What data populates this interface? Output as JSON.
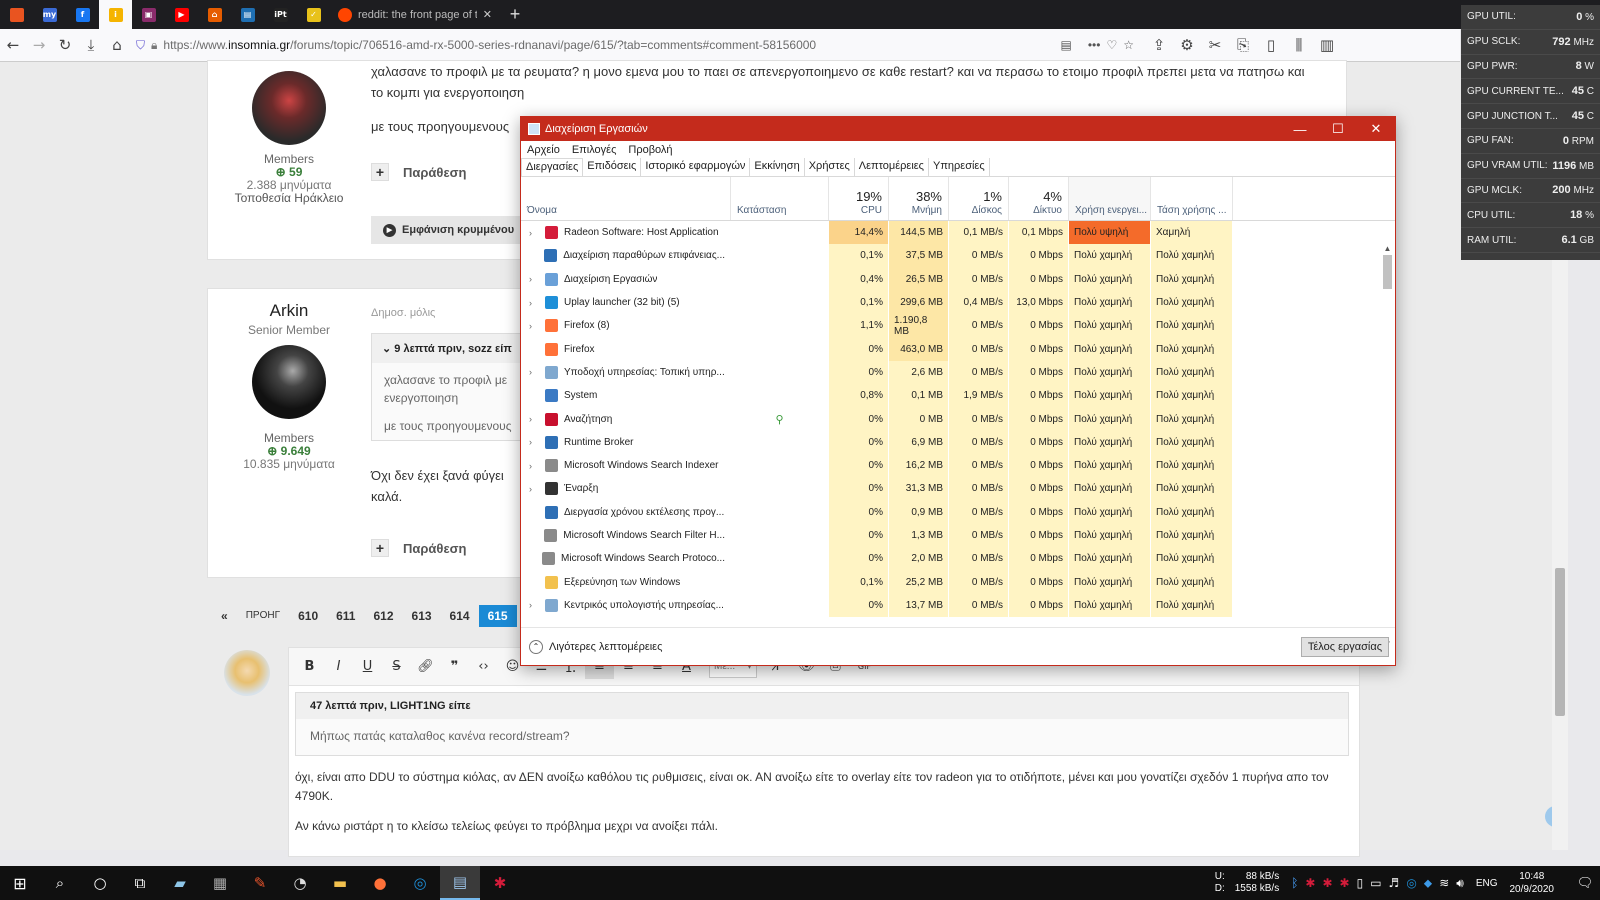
{
  "browser": {
    "tabs": [
      {
        "icon": "ubuntu-icon",
        "color": "#e95420",
        "glyph": ""
      },
      {
        "icon": "tab-icon-blue",
        "color": "#3b6bd6",
        "glyph": "my"
      },
      {
        "icon": "facebook-icon",
        "color": "#1877f2",
        "glyph": "f"
      },
      {
        "icon": "insomnia-icon",
        "color": "#f5b400",
        "glyph": "i"
      },
      {
        "icon": "site-icon",
        "color": "#8a2b6b",
        "glyph": "▣"
      },
      {
        "icon": "youtube-icon",
        "color": "#ff0000",
        "glyph": "▶"
      },
      {
        "icon": "site-icon-orange",
        "color": "#e65c00",
        "glyph": "⌂"
      },
      {
        "icon": "site-icon-blue",
        "color": "#1f6fb2",
        "glyph": "▤"
      },
      {
        "icon": "ipt-icon",
        "color": "#222",
        "glyph": "iPt"
      },
      {
        "icon": "site-icon-yellow",
        "color": "#e8c21a",
        "glyph": "✓"
      }
    ],
    "active_tab_title": "reddit: the front page of the in...",
    "url_prefix": "https://www.",
    "url_host": "insomnia.gr",
    "url_rest": "/forums/topic/706516-amd-rx-5000-series-rdnanavi/page/615/?tab=comments#comment-58156000"
  },
  "post1": {
    "text_line1": "χαλασανε το προφιλ με τα ρευματα? η μονο εμενα μου το παει σε απενεργοποιημενο σε καθε restart? και να περασω το ετοιμο προφιλ πρεπει μετα να πατησω και",
    "text_line2": "το κομπι για ενεργοποιηση",
    "text_line3": "με τους προηγουμενους",
    "member_group": "Members",
    "rep": "59",
    "posts": "2.388 μηνύματα",
    "location": "Τοποθεσία Ηράκλειο",
    "quote_label": "Παράθεση",
    "hidden_label": "Εμφάνιση κρυμμένου"
  },
  "post2": {
    "author": "Arkin",
    "rank": "Senior Member",
    "time": "Δημοσ. μόλις",
    "quote_header": "9 λεπτά πριν, sozz είπ",
    "quote_line1": "χαλασανε το προφιλ με",
    "quote_line2": "ενεργοποιηση",
    "quote_line3": "με τους προηγουμενους",
    "member_group": "Members",
    "rep": "9.649",
    "posts": "10.835 μηνύματα",
    "body_line1": "Όχι δεν έχει ξανά φύγει",
    "body_line2": "καλά.",
    "quote_label": "Παράθεση"
  },
  "pagination": {
    "prev": "ΠΡΟΗΓ",
    "first": "«",
    "pages": [
      "610",
      "611",
      "612",
      "613",
      "614",
      "615"
    ],
    "current": "615"
  },
  "editor": {
    "font_select": "Μέ...",
    "quote_header": "47 λεπτά πριν, LIGHT1NG είπε",
    "quote_text": "Μήπως πατάς καταλαθος κανένα record/stream?",
    "line1": "όχι, είναι απο DDU το σύστημα κιόλας, αν ΔΕΝ ανοίξω καθόλου τις ρυθμισεις, είναι οκ. ΑΝ ανοίξω είτε το overlay είτε τον radeon για το οτιδήποτε, μένει και μου γονατίζει σχεδόν 1 πυρήνα απο τον",
    "line2": "4790K.",
    "line3": "Αν κάνω ριστάρτ η το  κλείσω τελείως φεύγει το πρόβλημα μεχρι να ανοίξει πάλι."
  },
  "taskmanager": {
    "title": "Διαχείριση Εργασιών",
    "menu": [
      "Αρχείο",
      "Επιλογές",
      "Προβολή"
    ],
    "tabs": [
      "Διεργασίες",
      "Επιδόσεις",
      "Ιστορικό εφαρμογών",
      "Εκκίνηση",
      "Χρήστες",
      "Λεπτομέρειες",
      "Υπηρεσίες"
    ],
    "headers": {
      "name": "Όνομα",
      "status": "Κατάσταση",
      "cpu_pct": "19%",
      "cpu": "CPU",
      "mem_pct": "38%",
      "mem": "Μνήμη",
      "disk_pct": "1%",
      "disk": "Δίσκος",
      "net_pct": "4%",
      "net": "Δίκτυο",
      "power": "Χρήση ενεργει...",
      "power_trend": "Τάση χρήσης ..."
    },
    "rows": [
      {
        "name": "Radeon Software: Host Application",
        "exp": true,
        "icon": "#d41c3a",
        "cpu": "14,4%",
        "mem": "144,5 MB",
        "disk": "0,1 MB/s",
        "net": "0,1 Mbps",
        "power": "Πολύ υψηλή",
        "trend": "Χαμηλή",
        "hot": true
      },
      {
        "name": "Διαχείριση παραθύρων επιφάνειας...",
        "exp": false,
        "icon": "#2e6fb5",
        "cpu": "0,1%",
        "mem": "37,5 MB",
        "disk": "0 MB/s",
        "net": "0 Mbps",
        "power": "Πολύ χαμηλή",
        "trend": "Πολύ χαμηλή"
      },
      {
        "name": "Διαχείριση Εργασιών",
        "exp": true,
        "icon": "#6aa0d8",
        "cpu": "0,4%",
        "mem": "26,5 MB",
        "disk": "0 MB/s",
        "net": "0 Mbps",
        "power": "Πολύ χαμηλή",
        "trend": "Πολύ χαμηλή"
      },
      {
        "name": "Uplay launcher (32 bit) (5)",
        "exp": true,
        "icon": "#1e8fd8",
        "cpu": "0,1%",
        "mem": "299,6 MB",
        "disk": "0,4 MB/s",
        "net": "13,0 Mbps",
        "power": "Πολύ χαμηλή",
        "trend": "Πολύ χαμηλή"
      },
      {
        "name": "Firefox (8)",
        "exp": true,
        "icon": "#ff7139",
        "cpu": "1,1%",
        "mem": "1.190,8 MB",
        "disk": "0 MB/s",
        "net": "0 Mbps",
        "power": "Πολύ χαμηλή",
        "trend": "Πολύ χαμηλή"
      },
      {
        "name": "Firefox",
        "exp": false,
        "icon": "#ff7139",
        "cpu": "0%",
        "mem": "463,0 MB",
        "disk": "0 MB/s",
        "net": "0 Mbps",
        "power": "Πολύ χαμηλή",
        "trend": "Πολύ χαμηλή"
      },
      {
        "name": "Υποδοχή υπηρεσίας: Τοπική υπηρ...",
        "exp": true,
        "icon": "#7fa8cf",
        "cpu": "0%",
        "mem": "2,6 MB",
        "disk": "0 MB/s",
        "net": "0 Mbps",
        "power": "Πολύ χαμηλή",
        "trend": "Πολύ χαμηλή"
      },
      {
        "name": "System",
        "exp": false,
        "icon": "#3b7ac4",
        "cpu": "0,8%",
        "mem": "0,1 MB",
        "disk": "1,9 MB/s",
        "net": "0 Mbps",
        "power": "Πολύ χαμηλή",
        "trend": "Πολύ χαμηλή"
      },
      {
        "name": "Αναζήτηση",
        "exp": true,
        "icon": "#c8102e",
        "cpu": "0%",
        "mem": "0 MB",
        "disk": "0 MB/s",
        "net": "0 Mbps",
        "power": "Πολύ χαμηλή",
        "trend": "Πολύ χαμηλή",
        "leaf": true
      },
      {
        "name": "Runtime Broker",
        "exp": true,
        "icon": "#2e6fb5",
        "cpu": "0%",
        "mem": "6,9 MB",
        "disk": "0 MB/s",
        "net": "0 Mbps",
        "power": "Πολύ χαμηλή",
        "trend": "Πολύ χαμηλή"
      },
      {
        "name": "Microsoft Windows Search Indexer",
        "exp": true,
        "icon": "#8a8a8a",
        "cpu": "0%",
        "mem": "16,2 MB",
        "disk": "0 MB/s",
        "net": "0 Mbps",
        "power": "Πολύ χαμηλή",
        "trend": "Πολύ χαμηλή"
      },
      {
        "name": "Έναρξη",
        "exp": true,
        "icon": "#333",
        "cpu": "0%",
        "mem": "31,3 MB",
        "disk": "0 MB/s",
        "net": "0 Mbps",
        "power": "Πολύ χαμηλή",
        "trend": "Πολύ χαμηλή"
      },
      {
        "name": "Διεργασία χρόνου εκτέλεσης προγ...",
        "exp": false,
        "icon": "#2e6fb5",
        "cpu": "0%",
        "mem": "0,9 MB",
        "disk": "0 MB/s",
        "net": "0 Mbps",
        "power": "Πολύ χαμηλή",
        "trend": "Πολύ χαμηλή"
      },
      {
        "name": "Microsoft Windows Search Filter H...",
        "exp": false,
        "icon": "#8a8a8a",
        "cpu": "0%",
        "mem": "1,3 MB",
        "disk": "0 MB/s",
        "net": "0 Mbps",
        "power": "Πολύ χαμηλή",
        "trend": "Πολύ χαμηλή"
      },
      {
        "name": "Microsoft Windows Search Protoco...",
        "exp": false,
        "icon": "#8a8a8a",
        "cpu": "0%",
        "mem": "2,0 MB",
        "disk": "0 MB/s",
        "net": "0 Mbps",
        "power": "Πολύ χαμηλή",
        "trend": "Πολύ χαμηλή"
      },
      {
        "name": "Εξερεύνηση των Windows",
        "exp": false,
        "icon": "#f2c14e",
        "cpu": "0,1%",
        "mem": "25,2 MB",
        "disk": "0 MB/s",
        "net": "0 Mbps",
        "power": "Πολύ χαμηλή",
        "trend": "Πολύ χαμηλή"
      },
      {
        "name": "Κεντρικός υπολογιστής υπηρεσίας...",
        "exp": true,
        "icon": "#7fa8cf",
        "cpu": "0%",
        "mem": "13,7 MB",
        "disk": "0 MB/s",
        "net": "0 Mbps",
        "power": "Πολύ χαμηλή",
        "trend": "Πολύ χαμηλή"
      }
    ],
    "fewer_details": "Λιγότερες λεπτομέρειες",
    "end_task": "Τέλος εργασίας"
  },
  "overlay": [
    {
      "label": "GPU UTIL:",
      "value": "0",
      "unit": "%"
    },
    {
      "label": "GPU SCLK:",
      "value": "792",
      "unit": "MHz"
    },
    {
      "label": "GPU PWR:",
      "value": "8",
      "unit": "W"
    },
    {
      "label": "GPU CURRENT TE...",
      "value": "45",
      "unit": "C"
    },
    {
      "label": "GPU JUNCTION T...",
      "value": "45",
      "unit": "C"
    },
    {
      "label": "GPU FAN:",
      "value": "0",
      "unit": "RPM"
    },
    {
      "label": "GPU VRAM UTIL:",
      "value": "1196",
      "unit": "MB"
    },
    {
      "label": "GPU MCLK:",
      "value": "200",
      "unit": "MHz"
    },
    {
      "label": "CPU UTIL:",
      "value": "18",
      "unit": "%"
    },
    {
      "label": "RAM UTIL:",
      "value": "6.1",
      "unit": "GB"
    }
  ],
  "taskbar": {
    "net_up_label": "U:",
    "net_up": "88 kB/s",
    "net_down_label": "D:",
    "net_down": "1558 kB/s",
    "lang": "ENG",
    "time": "10:48",
    "date": "20/9/2020"
  }
}
